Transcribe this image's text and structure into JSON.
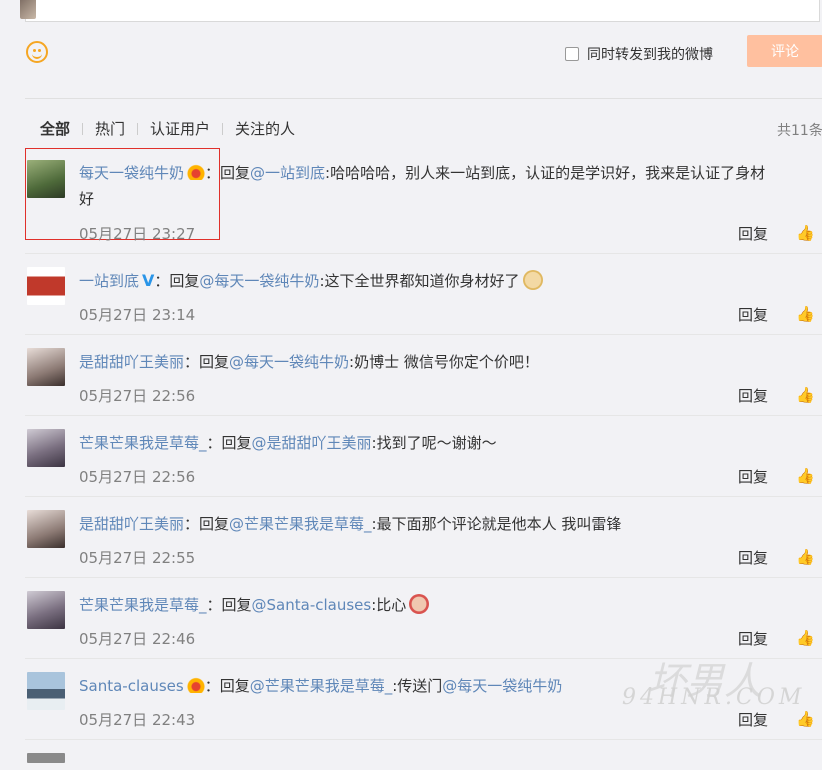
{
  "composer": {
    "forward_label": "同时转发到我的微博",
    "submit_label": "评论"
  },
  "tabs": [
    {
      "label": "全部"
    },
    {
      "label": "热门"
    },
    {
      "label": "认证用户"
    },
    {
      "label": "关注的人"
    }
  ],
  "total_label": "共11条",
  "comments": [
    {
      "user": "每天一袋纯牛奶",
      "badge": "crown",
      "pre": "：回复",
      "mention": "@一站到底",
      "text": ":哈哈哈哈，别人来一站到底，认证的是学识好，我来是认证了身材",
      "text2": "好",
      "time": "05月27日 23:27",
      "reply": "回复",
      "avatar_color": "#6b8a4e"
    },
    {
      "user": "一站到底",
      "badge": "v",
      "pre": "：回复",
      "mention": "@每天一袋纯牛奶",
      "text": ":这下全世界都知道你身材好了",
      "time": "05月27日 23:14",
      "reply": "回复",
      "avatar_color": "#c0392b",
      "emoji": "doge-emoji"
    },
    {
      "user": "是甜甜吖王美丽",
      "badge": "",
      "pre": "：回复",
      "mention": "@每天一袋纯牛奶",
      "text": ":奶博士 微信号你定个价吧！",
      "time": "05月27日 22:56",
      "reply": "回复",
      "avatar_color": "#b8a8a0"
    },
    {
      "user": "芒果芒果我是草莓_",
      "badge": "",
      "pre": "：回复",
      "mention": "@是甜甜吖王美丽",
      "text": ":找到了呢～谢谢～",
      "time": "05月27日 22:56",
      "reply": "回复",
      "avatar_color": "#8a7f8c"
    },
    {
      "user": "是甜甜吖王美丽",
      "badge": "",
      "pre": "：回复",
      "mention": "@芒果芒果我是草莓_",
      "text": ":最下面那个评论就是他本人 我叫雷锋",
      "time": "05月27日 22:55",
      "reply": "回复",
      "avatar_color": "#b8a8a0"
    },
    {
      "user": "芒果芒果我是草莓_",
      "badge": "",
      "pre": "：回复",
      "mention": "@Santa-clauses",
      "text": ":比心",
      "time": "05月27日 22:46",
      "reply": "回复",
      "avatar_color": "#8a7f8c",
      "emoji": "heart-hands-emoji"
    },
    {
      "user": "Santa-clauses",
      "badge": "crown",
      "pre": "：回复",
      "mention": "@芒果芒果我是草莓_",
      "text": ":传送门",
      "mention2": "@每天一袋纯牛奶",
      "time": "05月27日 22:43",
      "reply": "回复",
      "avatar_color": "#5a7a9a"
    }
  ],
  "watermark": "94HNR.COM",
  "watermark_big": "坏男人"
}
